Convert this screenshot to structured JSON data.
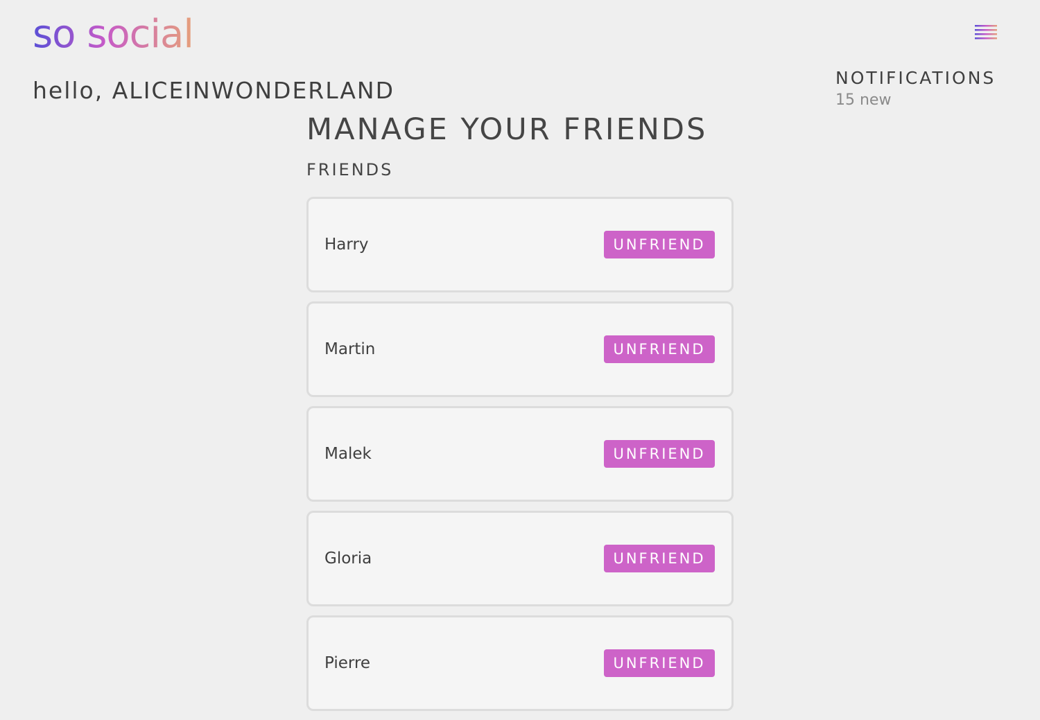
{
  "brand": {
    "logo_text": "so social",
    "colors": [
      "#5a4fd6",
      "#c65ac8",
      "#e6a07a"
    ]
  },
  "header": {
    "menu_icon": "hamburger-menu-icon"
  },
  "greeting": {
    "prefix": "hello,",
    "username": "ALICEINWONDERLAND"
  },
  "notifications": {
    "title": "NOTIFICATIONS",
    "count_text": "15 new"
  },
  "main": {
    "title": "MANAGE YOUR FRIENDS",
    "section_title": "FRIENDS",
    "unfriend_label": "UNFRIEND",
    "accent_color": "#cd63c8",
    "friends": [
      {
        "name": "Harry"
      },
      {
        "name": "Martin"
      },
      {
        "name": "Malek"
      },
      {
        "name": "Gloria"
      },
      {
        "name": "Pierre"
      }
    ]
  }
}
